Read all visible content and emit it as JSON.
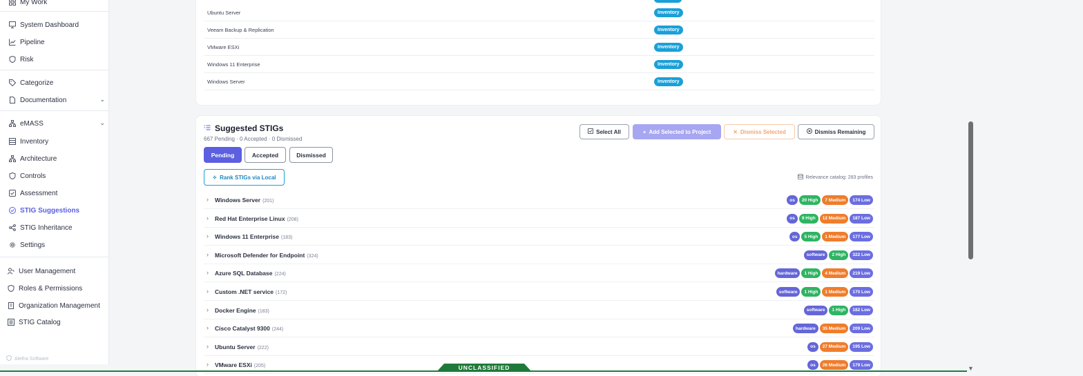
{
  "sidebar": {
    "items": [
      {
        "label": "My Work",
        "icon": "grid-icon"
      },
      {
        "label": "System Dashboard",
        "icon": "monitor-icon"
      },
      {
        "label": "Pipeline",
        "icon": "chart-line-icon"
      },
      {
        "label": "Risk",
        "icon": "shield-icon"
      },
      {
        "label": "Categorize",
        "icon": "tag-icon"
      },
      {
        "label": "Documentation",
        "icon": "file-icon"
      },
      {
        "label": "eMASS",
        "icon": "network-icon"
      },
      {
        "label": "Inventory",
        "icon": "list-icon"
      },
      {
        "label": "Architecture",
        "icon": "network-icon"
      },
      {
        "label": "Controls",
        "icon": "shield-icon"
      },
      {
        "label": "Assessment",
        "icon": "checkbox-icon"
      },
      {
        "label": "STIG Suggestions",
        "icon": "check-circle-icon"
      },
      {
        "label": "STIG Inheritance",
        "icon": "share-icon"
      },
      {
        "label": "Settings",
        "icon": "gear-icon"
      },
      {
        "label": "User Management",
        "icon": "user-key-icon"
      },
      {
        "label": "Roles & Permissions",
        "icon": "shield-icon"
      },
      {
        "label": "Organization Management",
        "icon": "building-icon"
      },
      {
        "label": "STIG Catalog",
        "icon": "catalog-icon"
      }
    ],
    "footer": "Aletha Software"
  },
  "inventory_rows": [
    {
      "name": "Ubuntu Server",
      "badge": "Inventory"
    },
    {
      "name": "Veeam Backup & Replication",
      "badge": "Inventory"
    },
    {
      "name": "VMware ESXi",
      "badge": "Inventory"
    },
    {
      "name": "Windows 11 Enterprise",
      "badge": "Inventory"
    },
    {
      "name": "Windows Server",
      "badge": "Inventory"
    }
  ],
  "stigs": {
    "title": "Suggested STIGs",
    "subtitle": "667 Pending · 0 Accepted · 0 Dismissed",
    "buttons": {
      "select_all": "Select All",
      "add_selected": "Add Selected to Project",
      "dismiss_selected": "Dismiss Selected",
      "dismiss_remaining": "Dismiss Remaining"
    },
    "tabs": [
      "Pending",
      "Accepted",
      "Dismissed"
    ],
    "rank_button": "Rank STIGs via Local",
    "catalog_text": "Relevance catalog: 283 profiles",
    "rows": [
      {
        "name": "Windows Server",
        "count": "(201)",
        "pills": [
          {
            "t": "type",
            "v": "os"
          },
          {
            "t": "high",
            "v": "20 High"
          },
          {
            "t": "med",
            "v": "7 Medium"
          },
          {
            "t": "low",
            "v": "174 Low"
          }
        ]
      },
      {
        "name": "Red Hat Enterprise Linux",
        "count": "(208)",
        "pills": [
          {
            "t": "type",
            "v": "os"
          },
          {
            "t": "high",
            "v": "9 High"
          },
          {
            "t": "med",
            "v": "12 Medium"
          },
          {
            "t": "low",
            "v": "187 Low"
          }
        ]
      },
      {
        "name": "Windows 11 Enterprise",
        "count": "(183)",
        "pills": [
          {
            "t": "type",
            "v": "os"
          },
          {
            "t": "high",
            "v": "5 High"
          },
          {
            "t": "med",
            "v": "1 Medium"
          },
          {
            "t": "low",
            "v": "177 Low"
          }
        ]
      },
      {
        "name": "Microsoft Defender for Endpoint",
        "count": "(324)",
        "pills": [
          {
            "t": "type",
            "v": "software"
          },
          {
            "t": "high",
            "v": "2 High"
          },
          {
            "t": "low",
            "v": "322 Low"
          }
        ]
      },
      {
        "name": "Azure SQL Database",
        "count": "(224)",
        "pills": [
          {
            "t": "type",
            "v": "hardware"
          },
          {
            "t": "high",
            "v": "1 High"
          },
          {
            "t": "med",
            "v": "4 Medium"
          },
          {
            "t": "low",
            "v": "219 Low"
          }
        ]
      },
      {
        "name": "Custom .NET service",
        "count": "(172)",
        "pills": [
          {
            "t": "type",
            "v": "software"
          },
          {
            "t": "high",
            "v": "1 High"
          },
          {
            "t": "med",
            "v": "1 Medium"
          },
          {
            "t": "low",
            "v": "170 Low"
          }
        ]
      },
      {
        "name": "Docker Engine",
        "count": "(183)",
        "pills": [
          {
            "t": "type",
            "v": "software"
          },
          {
            "t": "high",
            "v": "1 High"
          },
          {
            "t": "low",
            "v": "182 Low"
          }
        ]
      },
      {
        "name": "Cisco Catalyst 9300",
        "count": "(244)",
        "pills": [
          {
            "t": "type",
            "v": "hardware"
          },
          {
            "t": "med",
            "v": "35 Medium"
          },
          {
            "t": "low",
            "v": "209 Low"
          }
        ]
      },
      {
        "name": "Ubuntu Server",
        "count": "(222)",
        "pills": [
          {
            "t": "type",
            "v": "os"
          },
          {
            "t": "med",
            "v": "27 Medium"
          },
          {
            "t": "low",
            "v": "195 Low"
          }
        ]
      },
      {
        "name": "VMware ESXi",
        "count": "(205)",
        "pills": [
          {
            "t": "type",
            "v": "os"
          },
          {
            "t": "med",
            "v": "26 Medium"
          },
          {
            "t": "low",
            "v": "179 Low"
          }
        ]
      }
    ]
  },
  "classification": "UNCLASSIFIED",
  "colors": {
    "accent": "#5b5fe0",
    "inventory_badge": "#1aa0d8",
    "high": "#2fb463",
    "medium": "#ef7d2c",
    "low": "#6b6ee0",
    "banner": "#1f7a3a"
  }
}
